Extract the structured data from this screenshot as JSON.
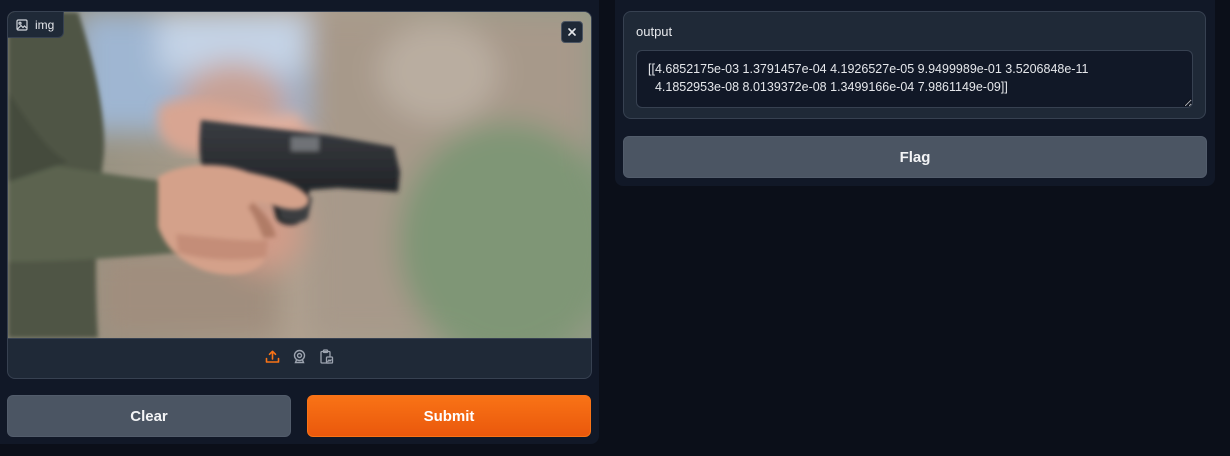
{
  "input": {
    "label": "img",
    "image_description_icon": "image-icon",
    "close_icon": "close-icon",
    "sources": [
      "upload-icon",
      "webcam-icon",
      "clipboard-icon"
    ]
  },
  "buttons": {
    "clear": "Clear",
    "submit": "Submit",
    "flag": "Flag"
  },
  "output": {
    "label": "output",
    "value": "[[4.6852175e-03 1.3791457e-04 4.1926527e-05 9.9499989e-01 3.5206848e-11\n  4.1852953e-08 8.0139372e-08 1.3499166e-04 7.9861149e-09]]"
  },
  "colors": {
    "background": "#0b0f19",
    "panel": "#111827",
    "block": "#1f2937",
    "accent": "#f97316",
    "secondary_button": "#4b5563"
  }
}
